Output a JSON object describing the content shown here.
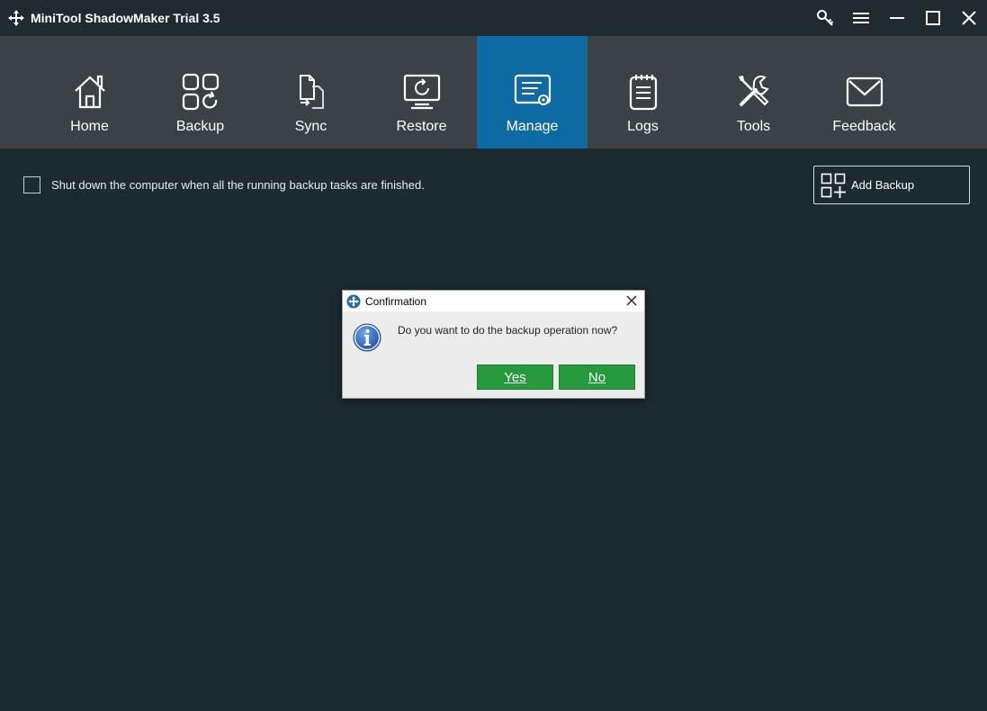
{
  "window": {
    "title": "MiniTool ShadowMaker Trial 3.5",
    "logo_icon": "minitool-logo-icon",
    "controls": [
      "key-icon",
      "menu-icon",
      "minimize-icon",
      "maximize-icon",
      "close-icon"
    ]
  },
  "nav": {
    "active_color": "#0e6aa2",
    "items": [
      {
        "label": "Home",
        "icon": "home-icon",
        "active": false
      },
      {
        "label": "Backup",
        "icon": "backup-icon",
        "active": false
      },
      {
        "label": "Sync",
        "icon": "sync-icon",
        "active": false
      },
      {
        "label": "Restore",
        "icon": "restore-icon",
        "active": false
      },
      {
        "label": "Manage",
        "icon": "manage-icon",
        "active": true
      },
      {
        "label": "Logs",
        "icon": "logs-icon",
        "active": false
      },
      {
        "label": "Tools",
        "icon": "tools-icon",
        "active": false
      },
      {
        "label": "Feedback",
        "icon": "feedback-icon",
        "active": false
      }
    ]
  },
  "manage": {
    "shutdown_label": "Shut down the computer when all the running backup tasks are finished.",
    "shutdown_checked": false,
    "add_backup_label": "Add Backup"
  },
  "dialog": {
    "title": "Confirmation",
    "message": "Do you want to do the backup operation now?",
    "yes_label": "Yes",
    "no_label": "No",
    "button_color": "#269a3c"
  }
}
